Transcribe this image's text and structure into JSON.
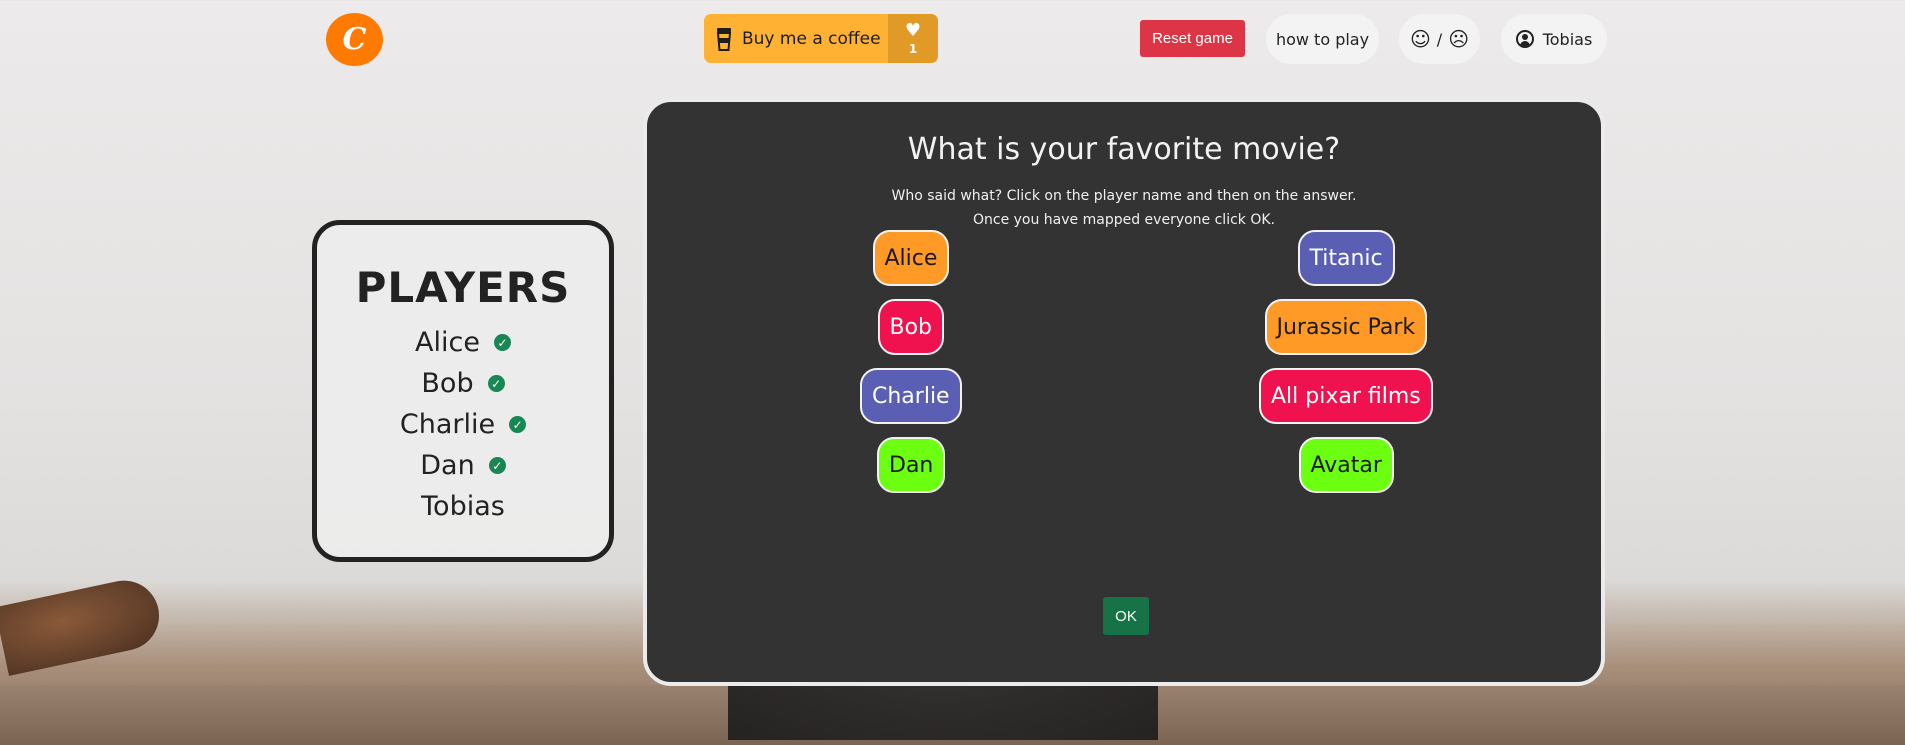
{
  "header": {
    "logo_letter": "C",
    "coffee_label": "Buy me a coffee",
    "coffee_likes": "1",
    "reset_label": "Reset game",
    "howto_label": "how to play",
    "feedback_happy": "☺",
    "feedback_sep": "/",
    "feedback_sad": "☹",
    "user_name": "Tobias"
  },
  "players_panel": {
    "title": "PLAYERS",
    "players": [
      {
        "name": "Alice",
        "done": true
      },
      {
        "name": "Bob",
        "done": true
      },
      {
        "name": "Charlie",
        "done": true
      },
      {
        "name": "Dan",
        "done": true
      },
      {
        "name": "Tobias",
        "done": false
      }
    ]
  },
  "question": {
    "title": "What is your favorite movie?",
    "instructions_line1": "Who said what? Click on the player name and then on the answer.",
    "instructions_line2": "Once you have mapped everyone click OK.",
    "names": [
      {
        "label": "Alice",
        "color": "#ff9a26",
        "text_color": "#1a1a1a"
      },
      {
        "label": "Bob",
        "color": "#f0124f",
        "text_color": "#ffffff"
      },
      {
        "label": "Charlie",
        "color": "#5a5fb4",
        "text_color": "#ffffff"
      },
      {
        "label": "Dan",
        "color": "#6dff12",
        "text_color": "#1a1a1a"
      }
    ],
    "answers": [
      {
        "label": "Titanic",
        "color": "#5a5fb4",
        "text_color": "#ffffff"
      },
      {
        "label": "Jurassic Park",
        "color": "#ff9a26",
        "text_color": "#1a1a1a"
      },
      {
        "label": "All pixar films",
        "color": "#f0124f",
        "text_color": "#ffffff"
      },
      {
        "label": "Avatar",
        "color": "#6dff12",
        "text_color": "#1a1a1a"
      }
    ],
    "ok_label": "OK"
  }
}
